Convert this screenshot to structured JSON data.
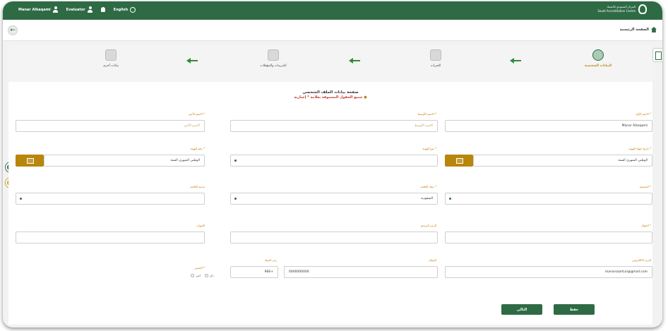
{
  "topbar": {
    "user_name": "Manar Alkaqami",
    "role": "Evaluator",
    "language": "English",
    "brand_ar": "المركز السعودي للاعتماد",
    "brand_en": "Saudi Accreditation Centre"
  },
  "breadcrumb": {
    "home_label": "الصفحة الرئيسية"
  },
  "steps": [
    {
      "label": "البيانات الشخصية",
      "active": true
    },
    {
      "label": "الخبرات",
      "active": false
    },
    {
      "label": "التدريبات والمؤهلات",
      "active": false
    },
    {
      "label": "بيانات أخرى",
      "active": false
    }
  ],
  "form": {
    "title": "صفحة بيانات الملف الشخصي",
    "note": "جميع الحقول المسبوقة بعلامة * إجبارية",
    "first_name": {
      "label": "الاسم الأول *",
      "value": "Manar Alkaqami"
    },
    "father_name": {
      "label": "الاسم الأوسط *",
      "placeholder": "الاسم الأوسط"
    },
    "last_name": {
      "label": "الاسم الأخير *",
      "placeholder": "الاسم الأخير"
    },
    "id_type": {
      "label": "نوع الهوية *",
      "value": ""
    },
    "id_number": {
      "label": "رقم الهوية *",
      "value": "الوطني الشهري السنة"
    },
    "id_expiry": {
      "label": "تاريخ انتهاء الهوية *",
      "value": "الوطني الشهري السنة"
    },
    "nationality": {
      "label": "الجنسية *",
      "value": ""
    },
    "country": {
      "label": "دولة الإقامة *",
      "value": "السعودية"
    },
    "city": {
      "label": "مدينة الإقامة",
      "value": ""
    },
    "mobile_label": {
      "label": "الجوال *",
      "value": ""
    },
    "postal": {
      "label": "الرمز البريدي",
      "value": ""
    },
    "address": {
      "label": "العنوان",
      "value": ""
    },
    "email": {
      "label": "البريد الالكتروني",
      "value": "manarsaarturi@gmail.com"
    },
    "phone": {
      "label": "الجوال",
      "value": "0000000000"
    },
    "country_code": {
      "label": "رمز الدولة",
      "value": "966+"
    },
    "gender": {
      "label": "الجنس *",
      "male": "ذكر",
      "female": "أنثى"
    }
  },
  "actions": {
    "next": "التالي",
    "save": "حفظ"
  },
  "colors": {
    "primary": "#2e6b45",
    "accent": "#b8860b",
    "required": "#c0392b"
  }
}
